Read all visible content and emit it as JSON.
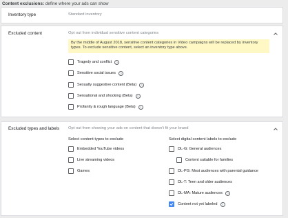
{
  "header": {
    "title": "Content exclusions:",
    "subtitle": "define where your ads can show"
  },
  "inventory": {
    "label": "Inventory type",
    "value": "Standard inventory"
  },
  "excluded_content": {
    "label": "Excluded content",
    "description": "Opt out from individual sensitive content categories",
    "notice_line1": "By the middle of August 2018, sensitive content categories in Video campaigns will be replaced by inventory",
    "notice_line2": "types. To exclude sensitive content, select an inventory type above.",
    "options": [
      {
        "label": "Tragedy and conflict",
        "checked": false
      },
      {
        "label": "Sensitive social issues",
        "checked": false
      },
      {
        "label": "Sexually suggestive content (Beta)",
        "checked": false
      },
      {
        "label": "Sensational and shocking (Beta)",
        "checked": false
      },
      {
        "label": "Profanity & rough language (Beta)",
        "checked": false
      }
    ]
  },
  "excluded_types": {
    "label": "Excluded types and labels",
    "description": "Opt out from showing your ads on content that doesn't fit your brand",
    "types_heading": "Select content types to exclude",
    "types": [
      {
        "label": "Embedded YouTube videos",
        "checked": false
      },
      {
        "label": "Live streaming videos",
        "checked": false
      },
      {
        "label": "Games",
        "checked": false
      }
    ],
    "labels_heading": "Select digital content labels to exclude",
    "labels": [
      {
        "label": "DL-G: General audiences",
        "checked": false
      },
      {
        "label": "Content suitable for families",
        "checked": false
      },
      {
        "label": "DL-PG: Most audiences with parental guidance",
        "checked": false
      },
      {
        "label": "DL-T: Teen and older audiences",
        "checked": false
      },
      {
        "label": "DL-MA: Mature audiences",
        "checked": false
      },
      {
        "label": "Content not yet labeled",
        "checked": true
      }
    ]
  },
  "colors": {
    "accent": "#4285f4",
    "notice_bg": "#fff8c5"
  }
}
